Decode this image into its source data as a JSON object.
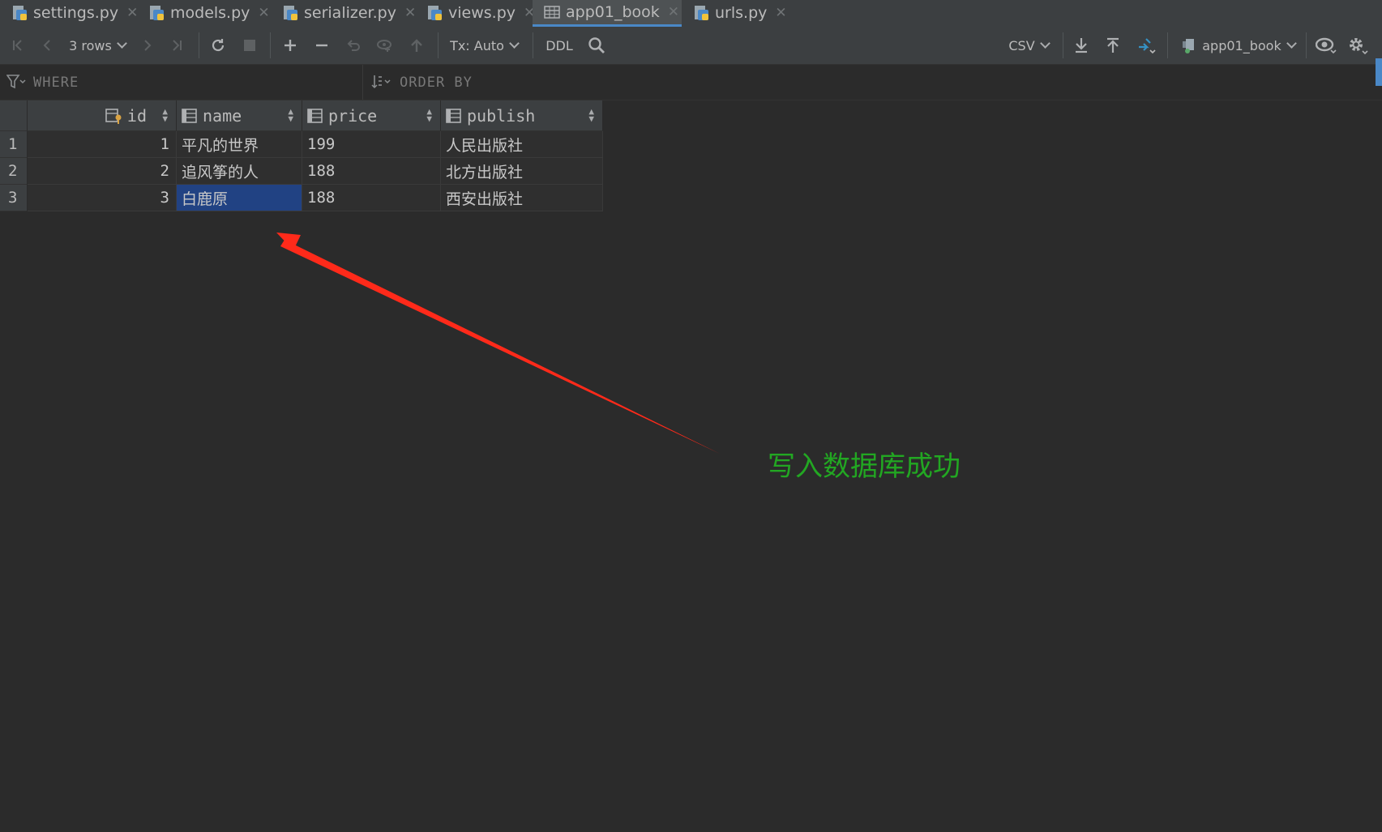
{
  "tabs": [
    {
      "label": "settings.py",
      "icon": "python-file-icon"
    },
    {
      "label": "models.py",
      "icon": "python-file-icon"
    },
    {
      "label": "serializer.py",
      "icon": "python-file-icon"
    },
    {
      "label": "views.py",
      "icon": "python-file-icon"
    },
    {
      "label": "app01_book",
      "icon": "table-icon",
      "active": true
    },
    {
      "label": "urls.py",
      "icon": "python-file-icon"
    }
  ],
  "toolbar": {
    "rows_label": "3 rows",
    "tx_label": "Tx: Auto",
    "ddl_label": "DDL",
    "export_format": "CSV",
    "datasource_label": "app01_book"
  },
  "filter": {
    "where_label": "WHERE",
    "order_by_label": "ORDER BY"
  },
  "grid": {
    "columns": [
      "id",
      "name",
      "price",
      "publish"
    ],
    "rows": [
      {
        "num": "1",
        "id": "1",
        "name": "平凡的世界",
        "price": "199",
        "publish": "人民出版社"
      },
      {
        "num": "2",
        "id": "2",
        "name": "追风筝的人",
        "price": "188",
        "publish": "北方出版社"
      },
      {
        "num": "3",
        "id": "3",
        "name": "白鹿原",
        "price": "188",
        "publish": "西安出版社"
      }
    ],
    "selected_cell": {
      "row": 3,
      "column": "name"
    }
  },
  "annotation": {
    "text": "写入数据库成功",
    "color": "#22a722",
    "arrow_color": "#ff2a1a"
  },
  "colors": {
    "background": "#2b2b2b",
    "toolbar": "#3c3f41",
    "accent": "#4a88c7",
    "selection": "#214283"
  }
}
